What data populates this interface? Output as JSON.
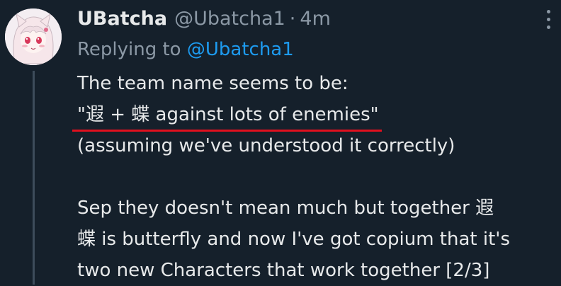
{
  "tweet": {
    "display_name": "UBatcha",
    "handle": "@Ubatcha1",
    "separator": "·",
    "time": "4m",
    "replying_prefix": "Replying to ",
    "replying_mention": "@Ubatcha1",
    "lines": [
      "The team name seems to be:",
      "\"遐 + 蝶 against lots of enemies\"",
      "(assuming we've understood it correctly)",
      "",
      "Sep they doesn't mean much but together 遐",
      "蝶 is butterfly and now I've got copium that it's",
      "two new Characters that work together [2/3]"
    ]
  },
  "colors": {
    "background": "#15202b",
    "text": "#e7e9ea",
    "secondary": "#8b98a5",
    "link": "#1d9bf0",
    "annotation_underline": "#e0101e"
  },
  "icons": {
    "more": "more-vertical-icon",
    "avatar": "anime-girl-avatar"
  }
}
